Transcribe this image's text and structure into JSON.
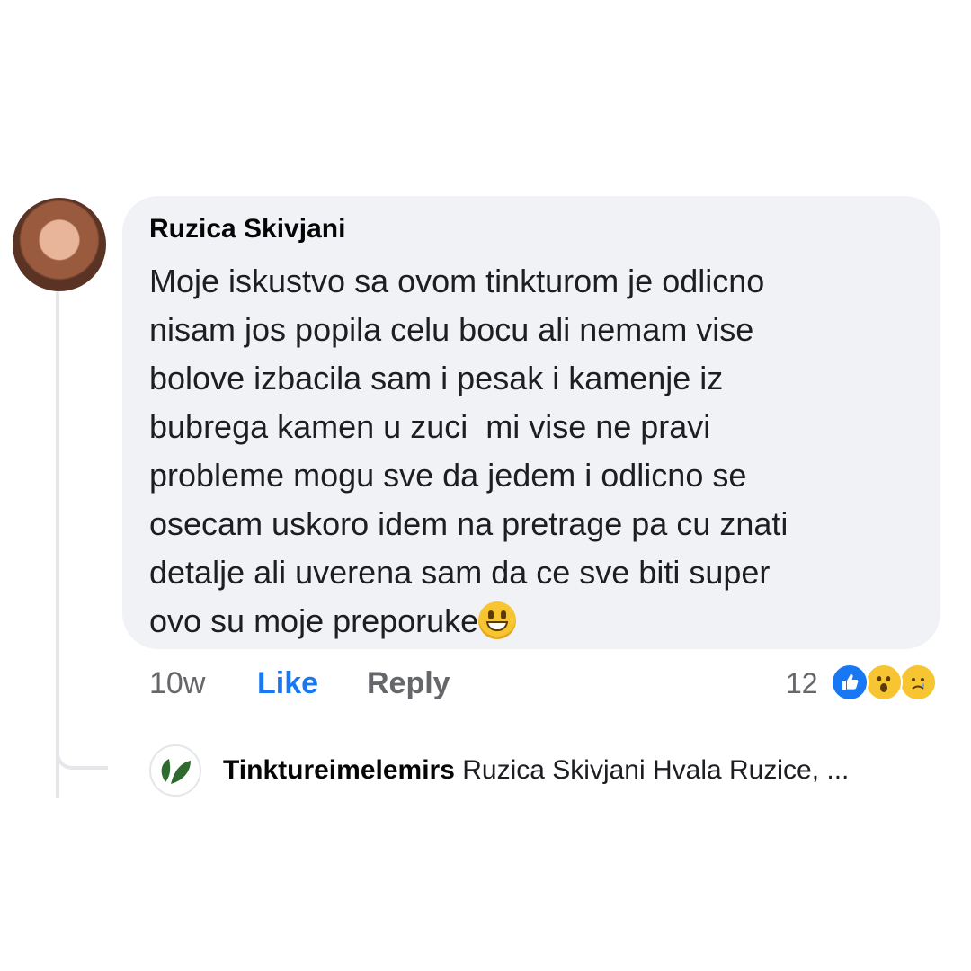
{
  "comment": {
    "author": "Ruzica Skivjani",
    "text": "Moje iskustvo sa ovom tinkturom je odlicno\nnisam jos popila celu bocu ali nemam vise\nbolove izbacila sam i pesak i kamenje iz\nbubrega kamen u zuci  mi vise ne pravi\nprobleme mogu sve da jedem i odlicno se\nosecam uskoro idem na pretrage pa cu znati\ndetalje ali uverena sam da ce sve biti super\novo su moje preporuke",
    "emoji": "grinning-face-emoji",
    "time": "10w",
    "like_label": "Like",
    "reply_label": "Reply",
    "reaction_count": "12",
    "reactions": [
      "like-icon",
      "wow-icon",
      "sad-icon"
    ]
  },
  "reply": {
    "author": "Tinktureimelemirs",
    "text": "Ruzica Skivjani Hvala Ruzice, ..."
  },
  "colors": {
    "bubble": "#f0f2f5",
    "link": "#1877f2",
    "muted": "#65676b",
    "logo_green": "#2f6b2f"
  }
}
